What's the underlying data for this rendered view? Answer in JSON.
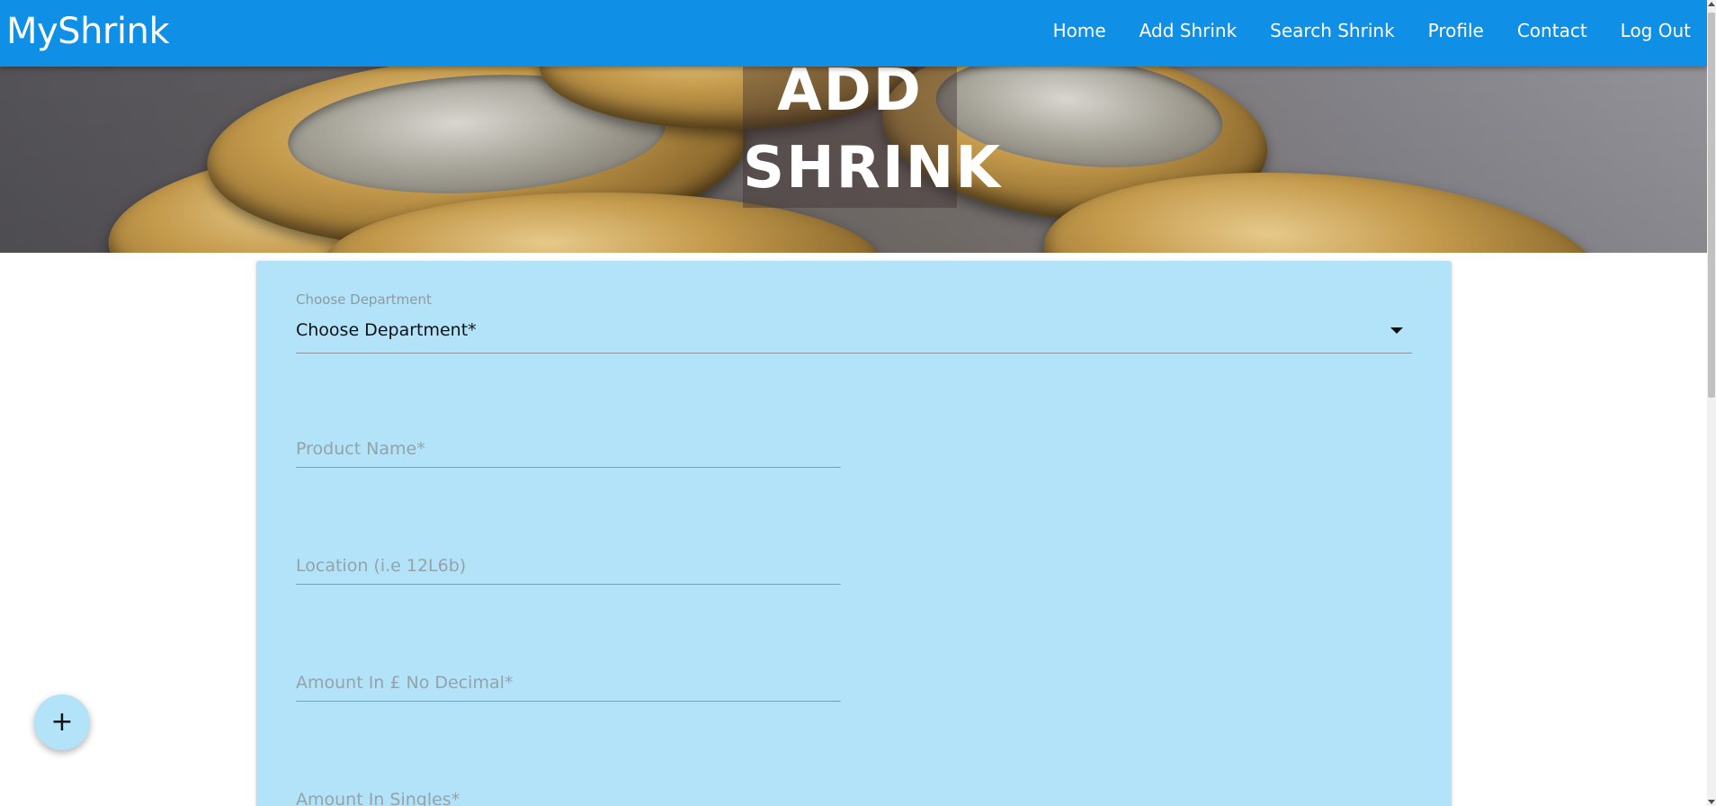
{
  "navbar": {
    "brand": "MyShrink",
    "links": [
      "Home",
      "Add Shrink",
      "Search Shrink",
      "Profile",
      "Contact",
      "Log Out"
    ]
  },
  "hero": {
    "title_line1": "ADD",
    "title_line2": "SHRINK"
  },
  "form": {
    "department": {
      "label": "Choose Department",
      "selected": "Choose Department*"
    },
    "product_name": {
      "placeholder": "Product Name*"
    },
    "location": {
      "placeholder": "Location (i.e 12L6b)"
    },
    "amount_pounds": {
      "placeholder": "Amount In £ No Decimal*"
    },
    "amount_singles": {
      "placeholder": "Amount In Singles*"
    }
  },
  "fab": {
    "label": "+"
  },
  "colors": {
    "navbar": "#0f90e6",
    "card": "#b3e3f8"
  }
}
